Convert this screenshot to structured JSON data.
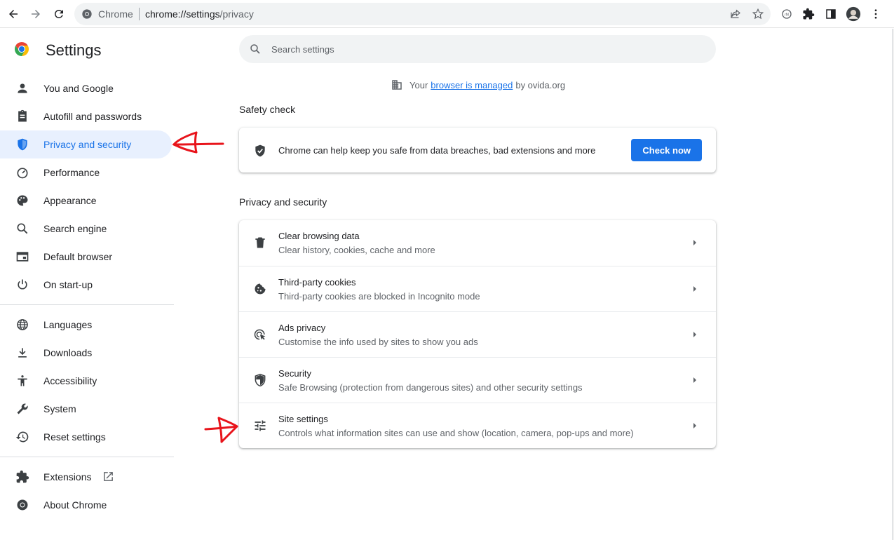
{
  "browser": {
    "origin_chip": "Chrome",
    "url_scheme_host": "chrome://settings",
    "url_path": "/privacy"
  },
  "sidebar": {
    "title": "Settings",
    "group1": [
      {
        "label": "You and Google",
        "icon": "person-icon"
      },
      {
        "label": "Autofill and passwords",
        "icon": "clipboard-icon"
      },
      {
        "label": "Privacy and security",
        "icon": "shield-icon",
        "active": true
      },
      {
        "label": "Performance",
        "icon": "speedometer-icon"
      },
      {
        "label": "Appearance",
        "icon": "palette-icon"
      },
      {
        "label": "Search engine",
        "icon": "search-icon"
      },
      {
        "label": "Default browser",
        "icon": "browser-window-icon"
      },
      {
        "label": "On start-up",
        "icon": "power-icon"
      }
    ],
    "group2": [
      {
        "label": "Languages",
        "icon": "globe-icon"
      },
      {
        "label": "Downloads",
        "icon": "download-icon"
      },
      {
        "label": "Accessibility",
        "icon": "accessibility-icon"
      },
      {
        "label": "System",
        "icon": "wrench-icon"
      },
      {
        "label": "Reset settings",
        "icon": "history-icon"
      }
    ],
    "group3": [
      {
        "label": "Extensions",
        "icon": "puzzle-icon"
      },
      {
        "label": "About Chrome",
        "icon": "chrome-logo-icon"
      }
    ]
  },
  "search": {
    "placeholder": "Search settings"
  },
  "managed": {
    "prefix": "Your",
    "link": "browser is managed",
    "suffix": "by ovida.org"
  },
  "safety_check": {
    "section_title": "Safety check",
    "text": "Chrome can help keep you safe from data breaches, bad extensions and more",
    "button": "Check now"
  },
  "privacy": {
    "section_title": "Privacy and security",
    "rows": [
      {
        "title": "Clear browsing data",
        "sub": "Clear history, cookies, cache and more"
      },
      {
        "title": "Third-party cookies",
        "sub": "Third-party cookies are blocked in Incognito mode"
      },
      {
        "title": "Ads privacy",
        "sub": "Customise the info used by sites to show you ads"
      },
      {
        "title": "Security",
        "sub": "Safe Browsing (protection from dangerous sites) and other security settings"
      },
      {
        "title": "Site settings",
        "sub": "Controls what information sites can use and show (location, camera, pop-ups and more)"
      }
    ]
  },
  "colors": {
    "accent": "#1a73e8",
    "active_bg": "#e8f0fe",
    "annotation": "#e8141b"
  }
}
